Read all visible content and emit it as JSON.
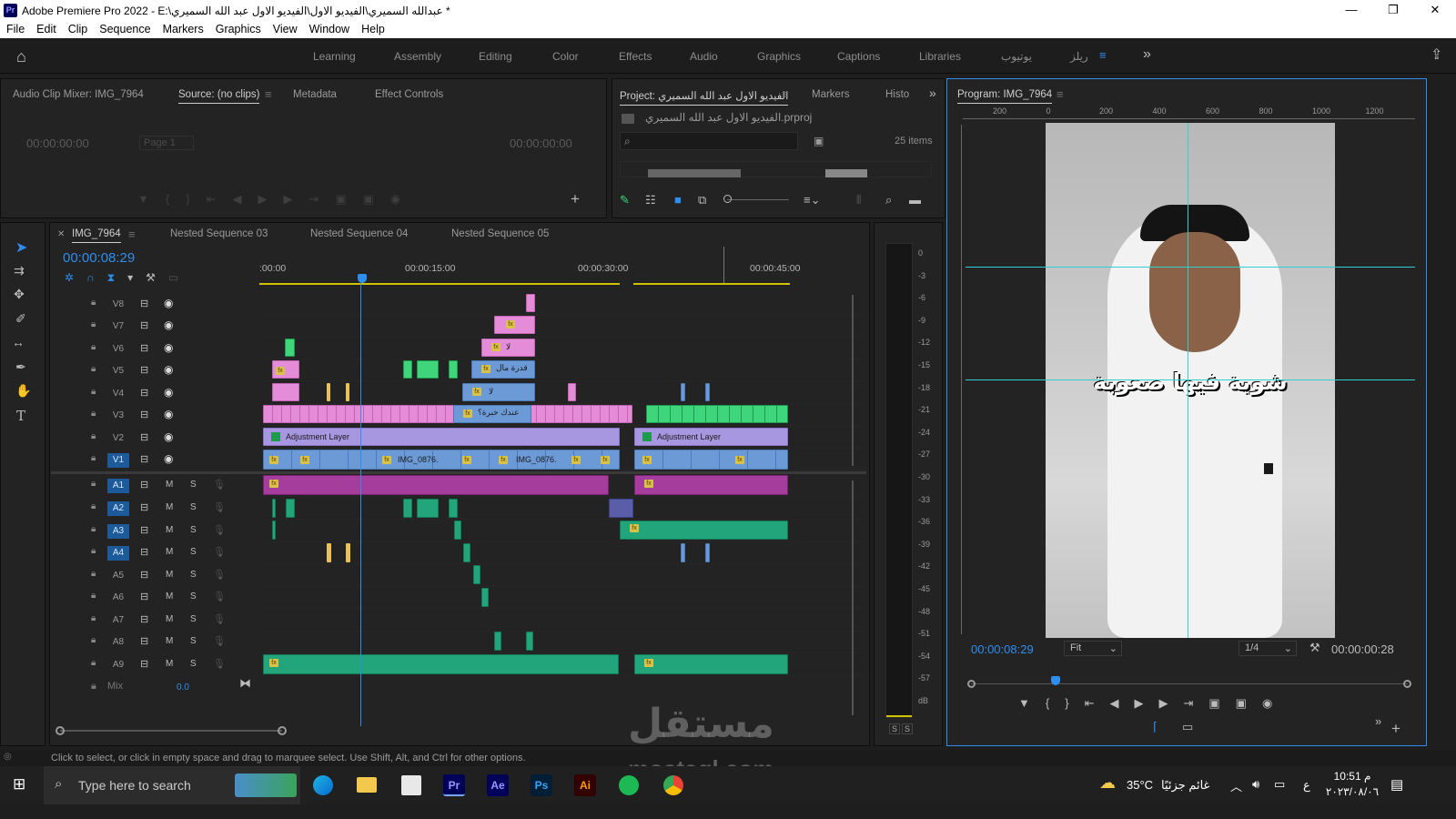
{
  "app": {
    "title": "Adobe Premiere Pro 2022 - E:\\عبدالله السميري\\الفيديو الاول\\الفيديو الاول عبد الله السميري *",
    "logo": "Pr",
    "min_icon": "minimize-icon",
    "max_icon": "restore-icon",
    "close_icon": "close-icon"
  },
  "menu": [
    "File",
    "Edit",
    "Clip",
    "Sequence",
    "Markers",
    "Graphics",
    "View",
    "Window",
    "Help"
  ],
  "workspaces": [
    "Learning",
    "Assembly",
    "Editing",
    "Color",
    "Effects",
    "Audio",
    "Graphics",
    "Captions",
    "Libraries",
    "يوتيوب",
    "ريلز"
  ],
  "active_workspace": "ريلز",
  "source_panel": {
    "tabs": [
      "Audio Clip Mixer: IMG_7964",
      "Source: (no clips)",
      "Metadata",
      "Effect Controls"
    ],
    "timecode_left": "00:00:00:00",
    "timecode_right": "00:00:00:00",
    "page": "Page 1"
  },
  "project_panel": {
    "tabs": [
      "Project: الفيديو الاول عبد الله السميري",
      "Markers",
      "Histo"
    ],
    "file": "الفيديو الاول عبد الله السميري.prproj",
    "items_count": "25 items"
  },
  "program_panel": {
    "tab": "Program: IMG_7964",
    "timecode": "00:00:08:29",
    "fit": "Fit",
    "resolution": "1/4",
    "duration": "00:00:00:28",
    "caption": "شوية فيها صعوبة",
    "ruler": [
      "200",
      "0",
      "200",
      "400",
      "600",
      "800",
      "1000",
      "1200"
    ]
  },
  "timeline": {
    "tabs": [
      "IMG_7964",
      "Nested Sequence 03",
      "Nested Sequence 04",
      "Nested Sequence 05"
    ],
    "timecode": "00:00:08:29",
    "ruler": [
      ":00:00",
      "00:00:15:00",
      "00:00:30:00",
      "00:00:45:00"
    ],
    "video_tracks": [
      "V8",
      "V7",
      "V6",
      "V5",
      "V4",
      "V3",
      "V2",
      "V1"
    ],
    "audio_tracks": [
      "A1",
      "A2",
      "A3",
      "A4",
      "A5",
      "A6",
      "A7",
      "A8",
      "A9"
    ],
    "mix_label": "Mix",
    "mix_value": "0.0",
    "clip_labels": {
      "adj1": "Adjustment Layer",
      "adj2": "Adjustment Layer",
      "img1": "IMG_0876.",
      "img2": "IMG_0876.",
      "v5text": "قدرة مال",
      "v6text": "لا",
      "v4text": "لا",
      "v3text": "عندك خبرة؟"
    }
  },
  "meter_scale": [
    "0",
    "-3",
    "-6",
    "-9",
    "-12",
    "-15",
    "-18",
    "-21",
    "-24",
    "-27",
    "-30",
    "-33",
    "-36",
    "-39",
    "-42",
    "-45",
    "-48",
    "-51",
    "-54",
    "-57",
    "dB"
  ],
  "meter_solo": [
    "S",
    "S"
  ],
  "status_text": "Click to select, or click in empty space and drag to marquee select. Use Shift, Alt, and Ctrl for other options.",
  "taskbar": {
    "search_placeholder": "Type here to search",
    "apps": [
      "Pr",
      "Ae",
      "Ps",
      "Ai"
    ],
    "weather_temp": "35°C",
    "weather_text": "غائم جزئيًا",
    "lang": "ع",
    "time": "10:51 م",
    "date": "٢٠٢٣/٠٨/٠٦"
  },
  "watermark": {
    "text1": "مستقل",
    "text2": "mostaql.com"
  }
}
